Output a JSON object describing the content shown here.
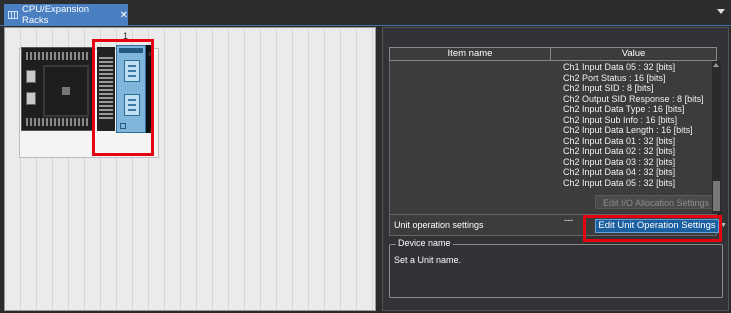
{
  "tab": {
    "title": "CPU/Expansion Racks",
    "close_glyph": "✕"
  },
  "rack": {
    "slot_number": "1",
    "dropdown_glyph": "▼",
    "info_glyph": "i"
  },
  "panel": {
    "column_headers": [
      "Item name",
      "Value"
    ],
    "values": [
      "Ch1 Input Data 05 : 32 [bits]",
      "Ch2 Port Status : 16 [bits]",
      "Ch2 Input SID : 8 [bits]",
      "Ch2 Output SID Response : 8 [bits]",
      "Ch2 Input Data Type : 16 [bits]",
      "Ch2 Input Sub Info : 16 [bits]",
      "Ch2 Input Data Length : 16 [bits]",
      "Ch2 Input Data 01 : 32 [bits]",
      "Ch2 Input Data 02 : 32 [bits]",
      "Ch2 Input Data 03 : 32 [bits]",
      "Ch2 Input Data 04 : 32 [bits]",
      "Ch2 Input Data 05 : 32 [bits]"
    ],
    "edit_io_button": "Edit I/O Allocation Settings",
    "unit_operation_label": "Unit operation settings",
    "unit_operation_value": "---",
    "edit_unit_button": "Edit Unit Operation Settings",
    "device_name_legend": "Device name",
    "device_name_desc": "Set a Unit name."
  },
  "colors": {
    "highlight": "#e50012",
    "tab_active": "#4a7fc1",
    "button_primary": "#1a5fa0",
    "unit_body": "#7fb6d9"
  }
}
